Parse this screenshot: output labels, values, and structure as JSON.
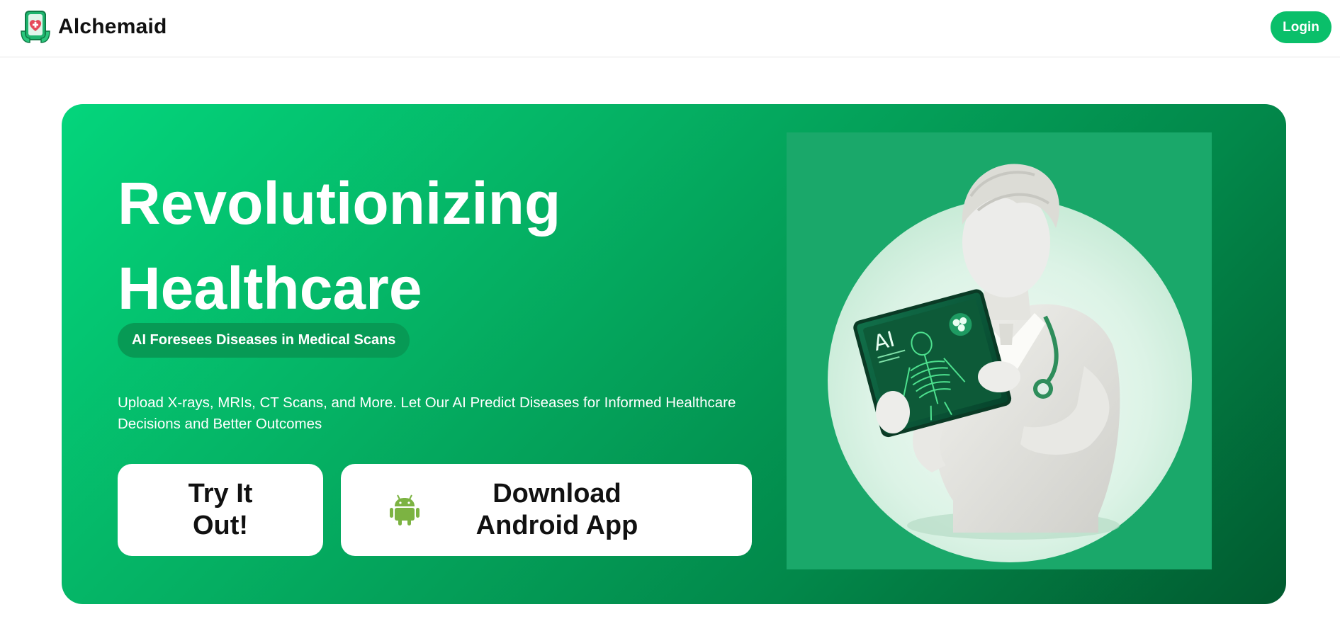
{
  "navbar": {
    "brand_name": "Alchemaid",
    "logo_icon": "medical-phone-heart-icon",
    "login_label": "Login"
  },
  "hero": {
    "headline_line1": "Revolutionizing",
    "headline_line2": "Healthcare",
    "pill_text": "AI Foresees Diseases in Medical Scans",
    "description": "Upload X-rays, MRIs, CT Scans, and More. Let Our AI Predict Diseases for Informed Healthcare Decisions and Better Outcomes",
    "try_label": "Try It Out!",
    "android_label": "Download Android App",
    "android_icon": "android-icon",
    "illustration": "doctor-holding-ai-xray-tablet",
    "tablet_text": "AI"
  },
  "colors": {
    "accent": "#0abf6a",
    "hero_gradient_start": "#04d57c",
    "hero_gradient_end": "#015a2f",
    "android_green": "#7cb342"
  }
}
